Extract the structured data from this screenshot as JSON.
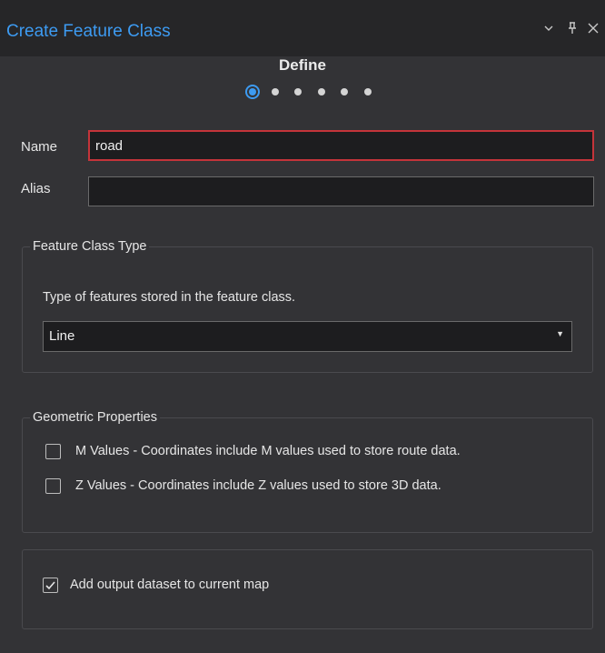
{
  "window": {
    "title": "Create Feature Class",
    "buttons": [
      "chevron-down-icon",
      "pin-icon",
      "close-icon"
    ],
    "accent_color": "#3d9bf2",
    "error_border_color": "#c4343a"
  },
  "wizard": {
    "step_title": "Define",
    "step_count": 6,
    "current_step": 1
  },
  "fields": {
    "name_label": "Name",
    "name_value": "road",
    "alias_label": "Alias",
    "alias_value": ""
  },
  "feature_class_type": {
    "legend": "Feature Class Type",
    "description": "Type of features stored in the feature class.",
    "selected": "Line"
  },
  "geometric_properties": {
    "legend": "Geometric Properties",
    "m_values": {
      "label": "M Values - Coordinates include M values used to store route data.",
      "checked": false
    },
    "z_values": {
      "label": "Z Values - Coordinates include Z values used to store 3D data.",
      "checked": false
    }
  },
  "output": {
    "add_to_map": {
      "label": "Add output dataset to current map",
      "checked": true
    }
  }
}
